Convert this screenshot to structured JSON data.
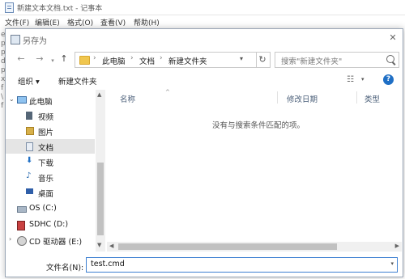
{
  "notepad": {
    "title": "新建文本文档.txt - 记事本",
    "menu": [
      "文件(F)",
      "编辑(E)",
      "格式(O)",
      "查看(V)",
      "帮助(H)"
    ],
    "left_chars": [
      "e",
      "p",
      "p",
      "d",
      "p",
      "x",
      "f",
      "\\",
      "f"
    ]
  },
  "dialog": {
    "title": "另存为",
    "close_glyph": "✕",
    "address": {
      "segments": [
        "此电脑",
        "文档",
        "新建文件夹"
      ],
      "separator": "›"
    },
    "search_placeholder": "搜索\"新建文件夹\"",
    "toolbar": {
      "organize": "组织 ▾",
      "new_folder": "新建文件夹",
      "view_glyph": "☷",
      "help": "?"
    },
    "nav_pane": [
      {
        "label": "此电脑",
        "icon": "computer-icon"
      },
      {
        "label": "视频",
        "icon": "video-icon"
      },
      {
        "label": "图片",
        "icon": "picture-icon"
      },
      {
        "label": "文档",
        "icon": "document-icon",
        "selected": true
      },
      {
        "label": "下载",
        "icon": "download-icon"
      },
      {
        "label": "音乐",
        "icon": "music-icon"
      },
      {
        "label": "桌面",
        "icon": "desktop-icon"
      },
      {
        "label": "OS (C:)",
        "icon": "drive-icon"
      },
      {
        "label": "SDHC (D:)",
        "icon": "sd-card-icon"
      },
      {
        "label": "CD 驱动器 (E:)",
        "icon": "cd-drive-icon"
      }
    ],
    "columns": [
      "名称",
      "修改日期",
      "类型"
    ],
    "empty_message": "没有与搜索条件匹配的项。",
    "filename_label": "文件名(N):",
    "filename_value": "test.cmd"
  }
}
